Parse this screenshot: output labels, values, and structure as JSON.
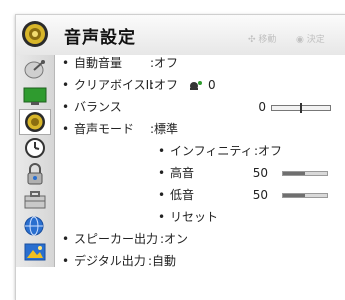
{
  "header": {
    "title": "音声設定",
    "move_hint": "移動",
    "ok_hint": "決定"
  },
  "sidebar": {
    "items": [
      {
        "icon": "satellite-dish-icon"
      },
      {
        "icon": "tv-screen-icon"
      },
      {
        "icon": "speaker-icon",
        "active": true
      },
      {
        "icon": "clock-icon"
      },
      {
        "icon": "lock-icon"
      },
      {
        "icon": "toolbox-icon"
      },
      {
        "icon": "network-globe-icon"
      },
      {
        "icon": "photo-media-icon"
      }
    ]
  },
  "settings": {
    "auto_volume": {
      "bullet": "•",
      "label": "自動音量",
      "value": ":オフ"
    },
    "clear_voice": {
      "bullet": "•",
      "label": "クリアボイスII",
      "value": ":オフ",
      "level": "0"
    },
    "balance": {
      "bullet": "•",
      "label": "バランス",
      "value": "0",
      "position": 0.5
    },
    "sound_mode": {
      "bullet": "•",
      "label": "音声モード",
      "value": ":標準"
    },
    "infinity": {
      "bullet": "•",
      "label": "インフィニティ",
      "value": ":オフ"
    },
    "treble": {
      "bullet": "•",
      "label": "高音",
      "value": "50",
      "level": 0.5
    },
    "bass": {
      "bullet": "•",
      "label": "低音",
      "value": "50",
      "level": 0.5
    },
    "reset": {
      "bullet": "•",
      "label": "リセット"
    },
    "speaker_output": {
      "bullet": "•",
      "label": "スピーカー出力",
      "value": ":オン"
    },
    "digital_output": {
      "bullet": "•",
      "label": "デジタル出力",
      "value": ":自動"
    }
  },
  "colors": {
    "header_bg": "#efefef",
    "sidebar_bg": "#e0e0e0",
    "icon_gold": "#c9a020",
    "icon_green": "#2f9b2f",
    "icon_blue": "#2a6fcf"
  }
}
